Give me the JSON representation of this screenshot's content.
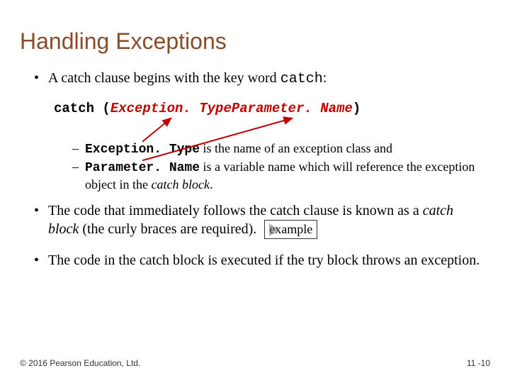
{
  "title": "Handling Exceptions",
  "bullet1_pre": "A catch clause begins with the key word ",
  "bullet1_kw": "catch",
  "bullet1_post": ":",
  "syntax": {
    "kw": "catch (",
    "type": "Exception. Type",
    "space": " ",
    "param": "Parameter. Name",
    "close": ")"
  },
  "sub1": {
    "code": "Exception. Type",
    "rest": " is the name of an exception class and"
  },
  "sub2": {
    "code": "Parameter. Name",
    "mid": " is a variable name which will reference the exception object in the ",
    "italic": "catch block",
    "end": "."
  },
  "bullet2_a": "The code that immediately follows the catch clause is known as a ",
  "bullet2_b": "catch block",
  "bullet2_c": " (the curly braces are required).",
  "example_label": "example",
  "bullet3": "The code in the catch block is executed if the try block throws an exception.",
  "footer_left": "© 2016 Pearson Education, Ltd.",
  "footer_right": "11 -10"
}
